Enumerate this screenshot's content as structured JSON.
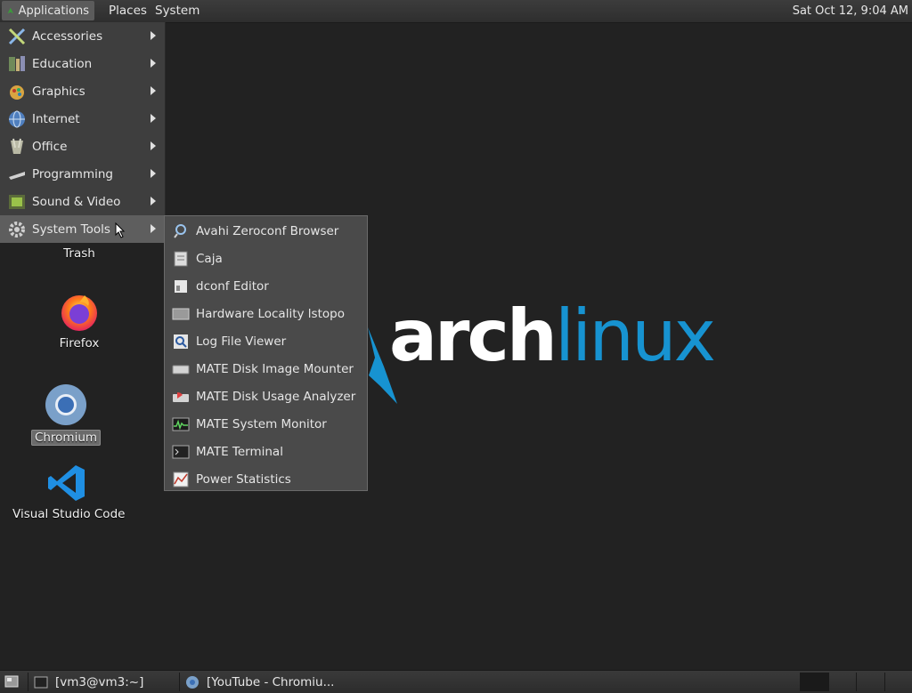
{
  "top_panel": {
    "applications": "Applications",
    "places": "Places",
    "system": "System",
    "clock": "Sat Oct 12,  9:04 AM"
  },
  "app_menu": {
    "items": [
      {
        "label": "Accessories",
        "icon": "accessories-icon"
      },
      {
        "label": "Education",
        "icon": "education-icon"
      },
      {
        "label": "Graphics",
        "icon": "graphics-icon"
      },
      {
        "label": "Internet",
        "icon": "internet-icon"
      },
      {
        "label": "Office",
        "icon": "office-icon"
      },
      {
        "label": "Programming",
        "icon": "programming-icon"
      },
      {
        "label": "Sound & Video",
        "icon": "sound-video-icon"
      },
      {
        "label": "System Tools",
        "icon": "system-tools-icon"
      }
    ]
  },
  "submenu": {
    "items": [
      {
        "label": "Avahi Zeroconf Browser",
        "icon": "avahi-icon"
      },
      {
        "label": "Caja",
        "icon": "caja-icon"
      },
      {
        "label": "dconf Editor",
        "icon": "dconf-icon"
      },
      {
        "label": "Hardware Locality lstopo",
        "icon": "hardware-icon"
      },
      {
        "label": "Log File Viewer",
        "icon": "log-viewer-icon"
      },
      {
        "label": "MATE Disk Image Mounter",
        "icon": "disk-mounter-icon"
      },
      {
        "label": "MATE Disk Usage Analyzer",
        "icon": "disk-usage-icon"
      },
      {
        "label": "MATE System Monitor",
        "icon": "system-monitor-icon"
      },
      {
        "label": "MATE Terminal",
        "icon": "terminal-icon"
      },
      {
        "label": "Power Statistics",
        "icon": "power-stats-icon"
      }
    ]
  },
  "desktop": {
    "trash": "Trash",
    "firefox": "Firefox",
    "chromium": "Chromium",
    "vscode": "Visual Studio Code"
  },
  "wallpaper": {
    "arch": "arch",
    "linux": "linux"
  },
  "taskbar": {
    "tasks": [
      {
        "label": "[vm3@vm3:~]"
      },
      {
        "label": "[YouTube - Chromiu..."
      }
    ]
  },
  "colors": {
    "arch_blue": "#1793d1",
    "panel": "#333333",
    "menu_bg": "#3e3e3e",
    "highlight": "#5e5e5e"
  }
}
